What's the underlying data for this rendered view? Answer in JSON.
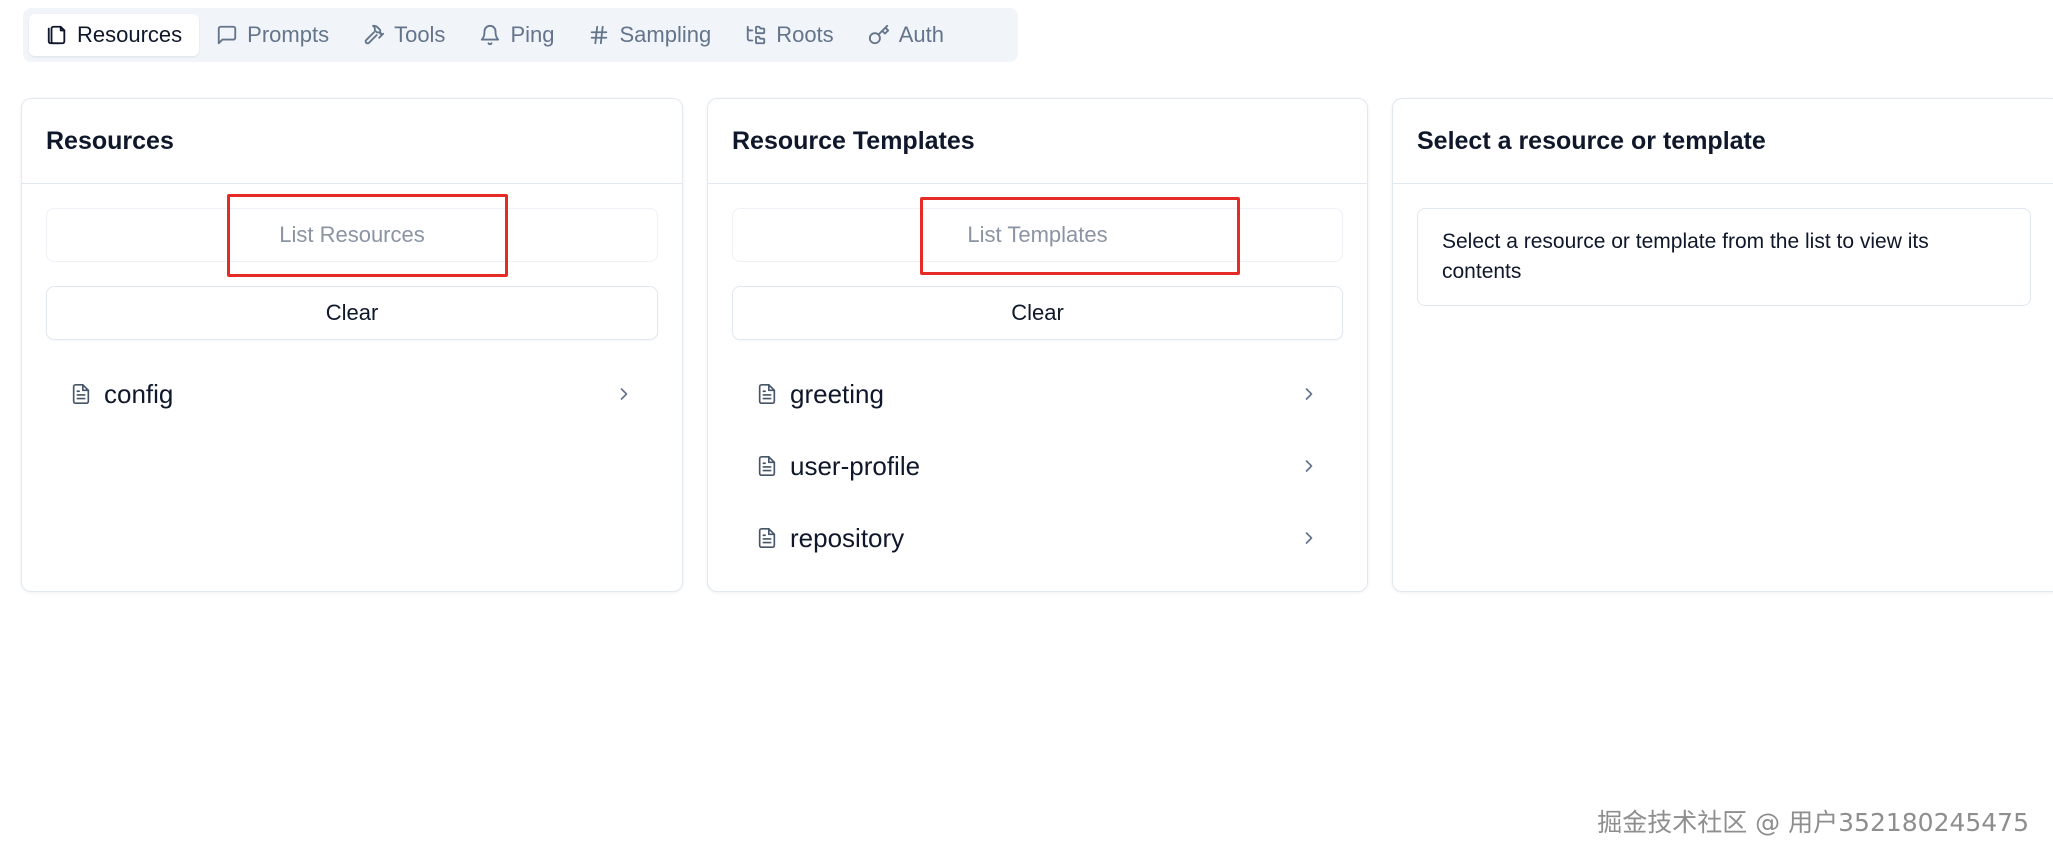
{
  "tabs": [
    {
      "label": "Resources",
      "icon": "files-icon",
      "active": true
    },
    {
      "label": "Prompts",
      "icon": "message-square-icon",
      "active": false
    },
    {
      "label": "Tools",
      "icon": "hammer-icon",
      "active": false
    },
    {
      "label": "Ping",
      "icon": "bell-icon",
      "active": false
    },
    {
      "label": "Sampling",
      "icon": "hash-icon",
      "active": false
    },
    {
      "label": "Roots",
      "icon": "folder-tree-icon",
      "active": false
    },
    {
      "label": "Auth",
      "icon": "key-icon",
      "active": false
    }
  ],
  "resources_panel": {
    "title": "Resources",
    "list_button": "List Resources",
    "clear_button": "Clear",
    "items": [
      "config"
    ]
  },
  "templates_panel": {
    "title": "Resource Templates",
    "list_button": "List Templates",
    "clear_button": "Clear",
    "items": [
      "greeting",
      "user-profile",
      "repository"
    ]
  },
  "detail_panel": {
    "title": "Select a resource or template",
    "message": "Select a resource or template from the list to view its contents"
  },
  "watermark": "掘金技术社区 @ 用户352180245475",
  "colors": {
    "highlight": "#e52b25",
    "tab_bar_bg": "#f1f5f9",
    "muted_text": "#64748b",
    "border": "#e2e8f0"
  }
}
